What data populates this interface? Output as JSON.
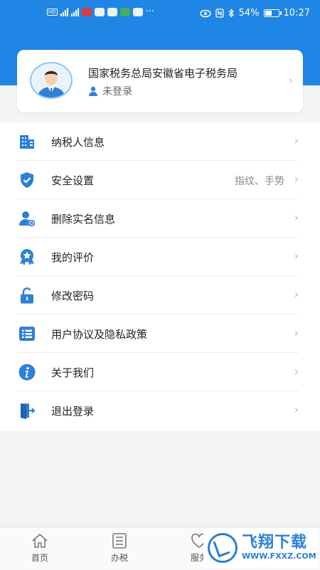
{
  "colors": {
    "accent": "#1f86e5",
    "icon_blue": "#2f80d6",
    "background": "#f4f4f4"
  },
  "status_bar": {
    "battery": "54%",
    "time": "10:27",
    "battery_level": 0.54
  },
  "profile": {
    "org_name": "国家税务总局安徽省电子税务局",
    "login_status": "未登录",
    "avatar_icon": "user-avatar-icon"
  },
  "menu": {
    "items": [
      {
        "label": "纳税人信息",
        "value": "",
        "icon": "building-icon"
      },
      {
        "label": "安全设置",
        "value": "指纹、手势",
        "icon": "shield-check-icon"
      },
      {
        "label": "删除实名信息",
        "value": "",
        "icon": "user-remove-icon"
      },
      {
        "label": "我的评价",
        "value": "",
        "icon": "star-badge-icon"
      },
      {
        "label": "修改密码",
        "value": "",
        "icon": "lock-open-icon"
      },
      {
        "label": "用户协议及隐私政策",
        "value": "",
        "icon": "list-icon"
      },
      {
        "label": "关于我们",
        "value": "",
        "icon": "info-icon"
      },
      {
        "label": "退出登录",
        "value": "",
        "icon": "logout-icon"
      }
    ]
  },
  "tabbar": {
    "tabs": [
      {
        "label": "首页",
        "icon": "home-icon"
      },
      {
        "label": "办税",
        "icon": "document-list-icon"
      },
      {
        "label": "服务",
        "icon": "heart-icon"
      }
    ]
  },
  "watermark": {
    "cn": "飞翔下载",
    "en": "WWW.FXXZ.COM"
  }
}
